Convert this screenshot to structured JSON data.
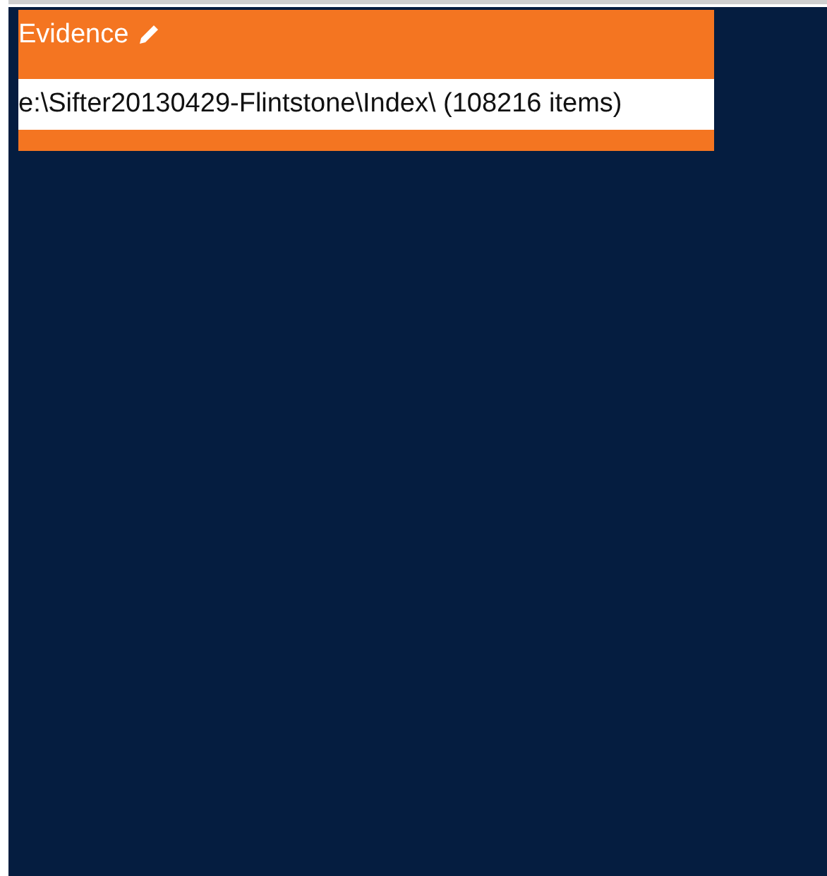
{
  "panel": {
    "title": "Evidence",
    "path": "e:\\Sifter20130429-Flintstone\\Index\\ (108216 items)"
  }
}
